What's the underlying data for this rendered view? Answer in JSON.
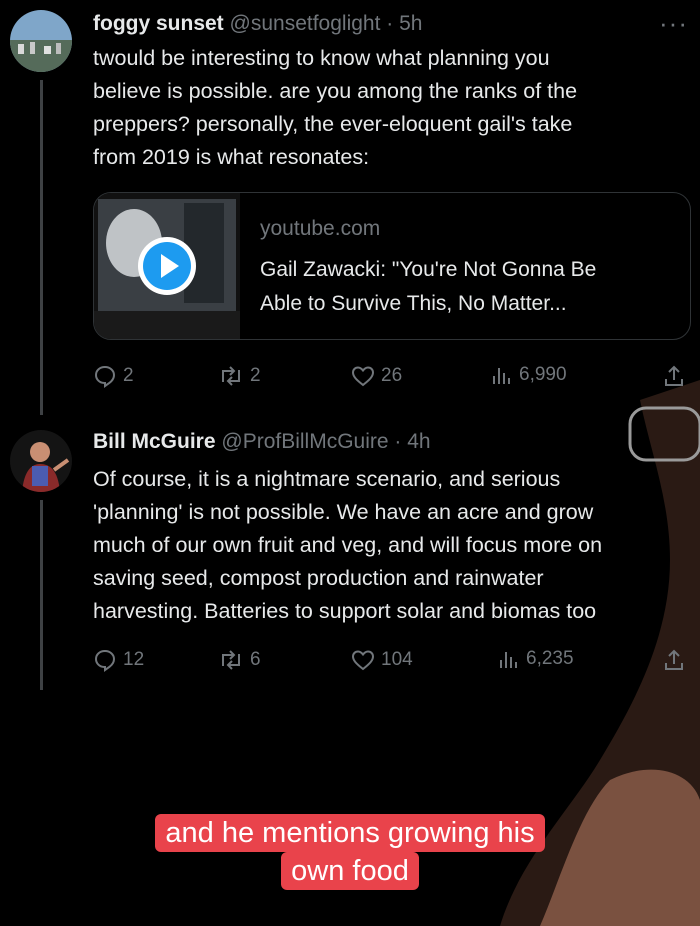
{
  "tweets": [
    {
      "display_name": "foggy sunset",
      "handle": "@sunsetfoglight",
      "time": "· 5h",
      "lines": [
        "twould be interesting to know what planning you",
        "believe is possible.  are you among the ranks of the",
        "preppers?  personally, the ever-eloquent gail's take",
        "from 2019 is what resonates:"
      ],
      "link_card": {
        "domain": "youtube.com",
        "title_lines": [
          "Gail Zawacki: \"You're Not Gonna Be",
          "Able to Survive This, No Matter..."
        ]
      },
      "replies": "2",
      "reposts": "2",
      "likes": "26",
      "views": "6,990",
      "more": "···"
    },
    {
      "display_name": "Bill McGuire",
      "handle": "@ProfBillMcGuire",
      "time": "· 4h",
      "lines": [
        "Of course, it is a nightmare scenario, and serious",
        "'planning' is not possible. We have an acre and grow",
        "much of our own fruit and veg, and will focus more on",
        "saving seed, compost production and rainwater",
        "harvesting. Batteries to support solar and biomas too"
      ],
      "replies": "12",
      "reposts": "6",
      "likes": "104",
      "views": "6,235"
    }
  ],
  "caption": [
    "and he mentions growing his",
    "own food"
  ],
  "icons": [
    "reply-icon",
    "repost-icon",
    "like-icon",
    "views-icon",
    "share-icon",
    "play-icon"
  ],
  "colors": {
    "accent": "#1d9bf0",
    "caption_bg": "#e9434b",
    "muted": "#71767b"
  }
}
